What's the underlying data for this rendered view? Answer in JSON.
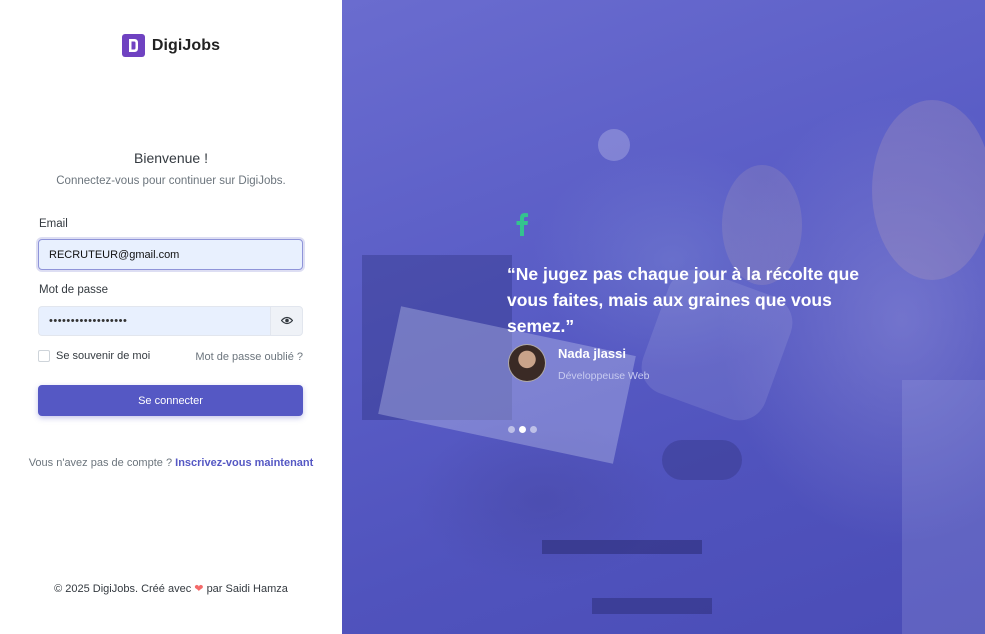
{
  "brand": {
    "name": "DigiJobs",
    "logo_icon": "digijobs-logo-icon",
    "logo_color": "#6f42c1"
  },
  "login": {
    "title": "Bienvenue !",
    "subtitle": "Connectez-vous pour continuer sur DigiJobs.",
    "email_label": "Email",
    "email_value": "RECRUTEUR@gmail.com",
    "password_label": "Mot de passe",
    "password_value": "••••••••••••••••••",
    "password_toggle_icon": "eye-icon",
    "remember_label": "Se souvenir de moi",
    "remember_checked": false,
    "forgot_label": "Mot de passe oublié ?",
    "submit_label": "Se connecter",
    "signup_prompt": "Vous n'avez pas de compte ?",
    "signup_link": "Inscrivez-vous maintenant"
  },
  "footer": {
    "prefix": "© 2025 DigiJobs. Créé avec",
    "heart_icon": "heart-icon",
    "suffix": "par Saidi Hamza"
  },
  "testimonial": {
    "quote_icon": "quote-icon",
    "quote": "“Ne jugez pas chaque jour à la récolte que vous faites, mais aux graines que vous semez.”",
    "author_name": "Nada jlassi",
    "author_role": "Développeuse Web",
    "slides_count": 3,
    "active_slide": 2
  },
  "colors": {
    "primary": "#5558c4",
    "accent_green": "#34c38f",
    "heart": "#f46a6a",
    "overlay": "#5558c4"
  }
}
